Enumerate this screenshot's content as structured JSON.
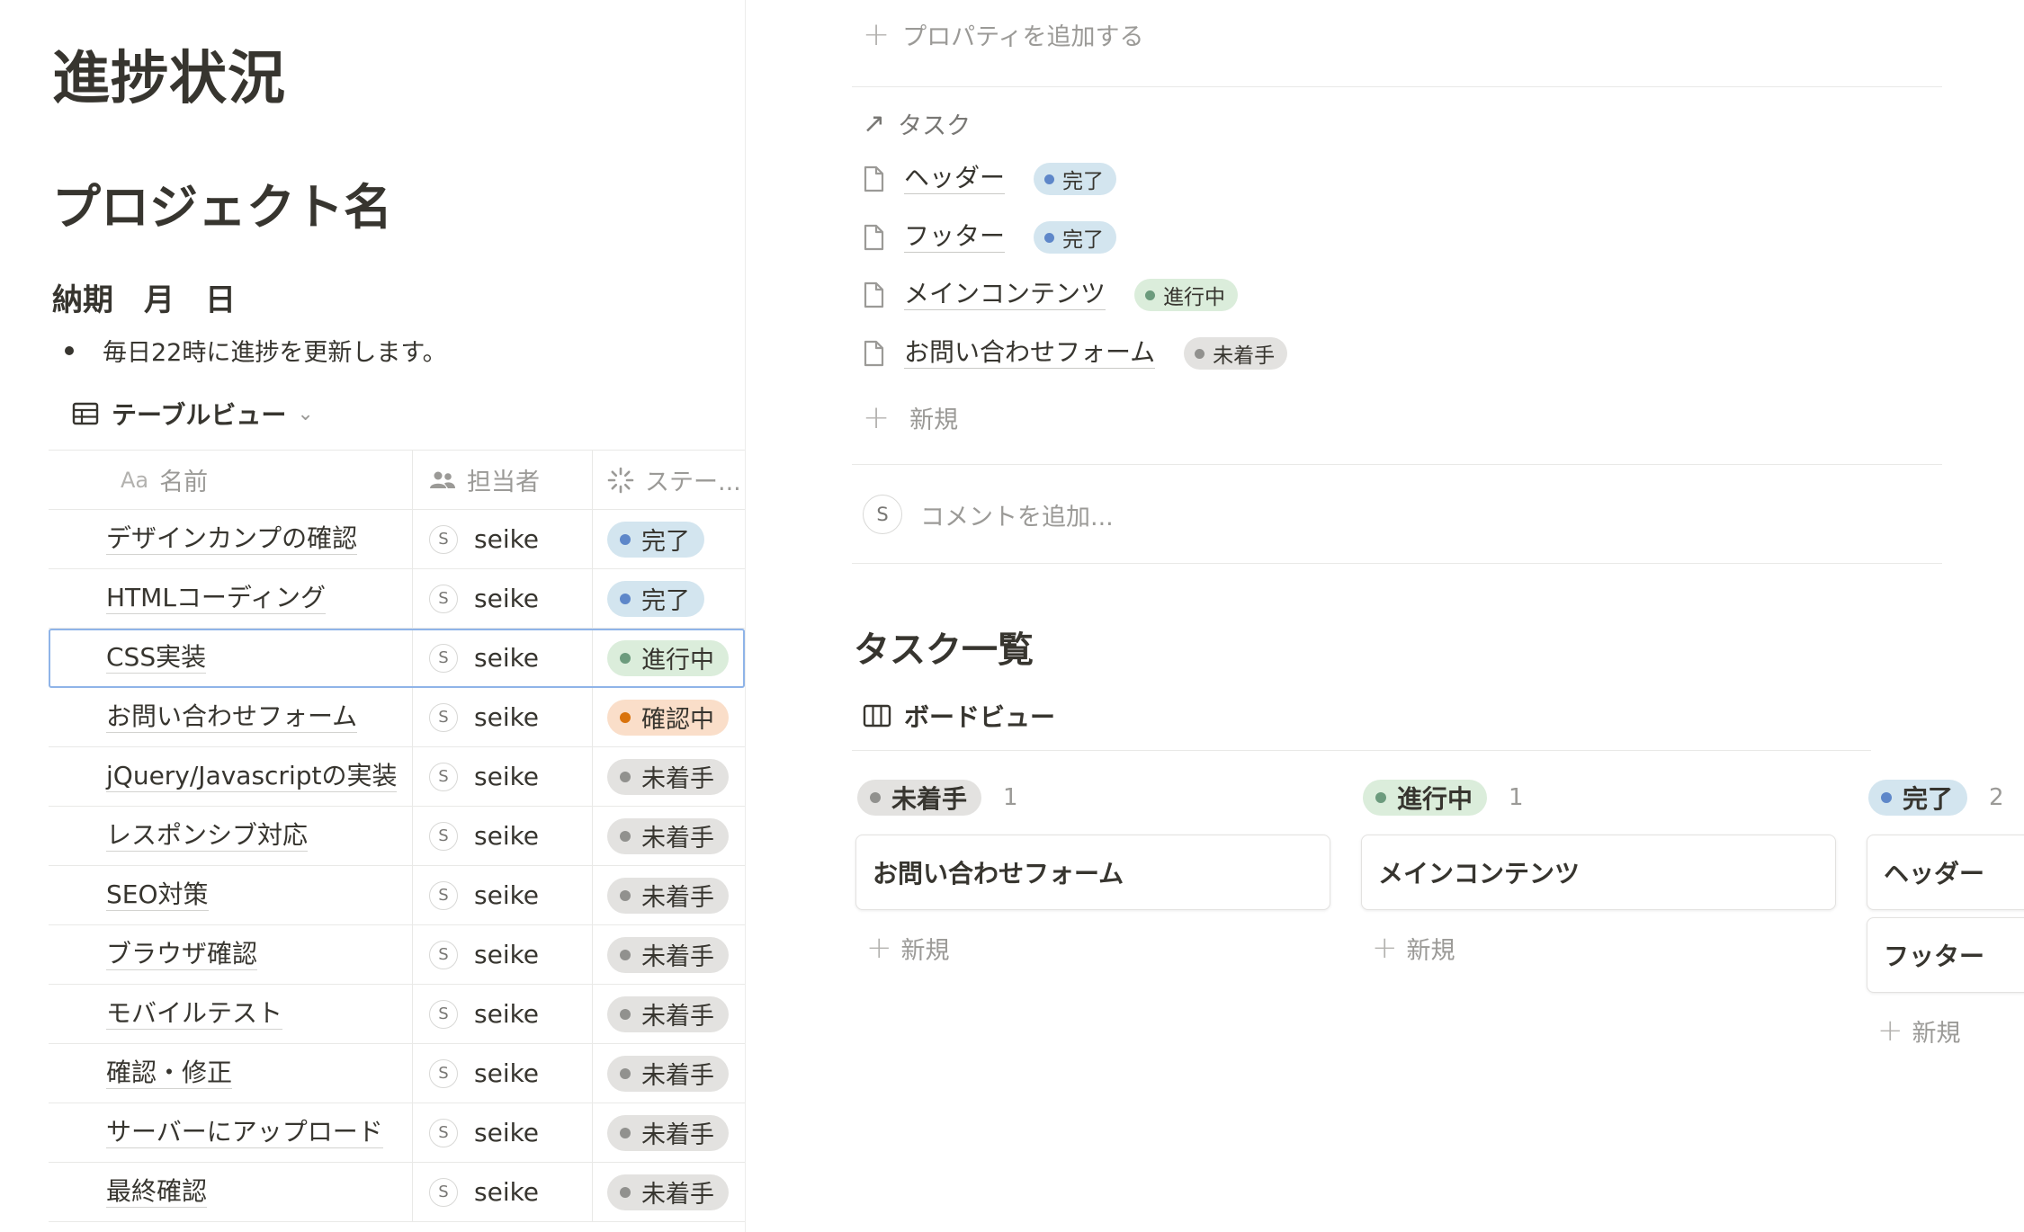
{
  "left": {
    "page_title": "進捗状況",
    "project_heading": "プロジェクト名",
    "due_heading": "納期　月　日",
    "bullet": "毎日22時に進捗を更新します。",
    "view_name": "テーブルビュー",
    "table": {
      "headers": {
        "name_prefix": "Aa",
        "name": "名前",
        "assignee": "担当者",
        "status": "ステー..."
      },
      "rows": [
        {
          "name": "デザインカンプの確認",
          "avatar": "S",
          "assignee": "seike",
          "status": "完了",
          "kind": "done"
        },
        {
          "name": "HTMLコーディング",
          "avatar": "S",
          "assignee": "seike",
          "status": "完了",
          "kind": "done"
        },
        {
          "name": "CSS実装",
          "avatar": "S",
          "assignee": "seike",
          "status": "進行中",
          "kind": "prog"
        },
        {
          "name": "お問い合わせフォーム",
          "avatar": "S",
          "assignee": "seike",
          "status": "確認中",
          "kind": "review"
        },
        {
          "name": "jQuery/Javascriptの実装",
          "avatar": "S",
          "assignee": "seike",
          "status": "未着手",
          "kind": "todo"
        },
        {
          "name": "レスポンシブ対応",
          "avatar": "S",
          "assignee": "seike",
          "status": "未着手",
          "kind": "todo"
        },
        {
          "name": "SEO対策",
          "avatar": "S",
          "assignee": "seike",
          "status": "未着手",
          "kind": "todo"
        },
        {
          "name": "ブラウザ確認",
          "avatar": "S",
          "assignee": "seike",
          "status": "未着手",
          "kind": "todo"
        },
        {
          "name": "モバイルテスト",
          "avatar": "S",
          "assignee": "seike",
          "status": "未着手",
          "kind": "todo"
        },
        {
          "name": "確認・修正",
          "avatar": "S",
          "assignee": "seike",
          "status": "未着手",
          "kind": "todo"
        },
        {
          "name": "サーバーにアップロード",
          "avatar": "S",
          "assignee": "seike",
          "status": "未着手",
          "kind": "todo"
        },
        {
          "name": "最終確認",
          "avatar": "S",
          "assignee": "seike",
          "status": "未着手",
          "kind": "todo"
        }
      ]
    }
  },
  "right": {
    "add_property": "プロパティを追加する",
    "relation_label": "タスク",
    "relations": [
      {
        "name": "ヘッダー",
        "status": "完了",
        "kind": "done"
      },
      {
        "name": "フッター",
        "status": "完了",
        "kind": "done"
      },
      {
        "name": "メインコンテンツ",
        "status": "進行中",
        "kind": "prog"
      },
      {
        "name": "お問い合わせフォーム",
        "status": "未着手",
        "kind": "todo"
      }
    ],
    "relation_new": "新規",
    "comment_avatar": "S",
    "comment_placeholder": "コメントを追加...",
    "tasks_heading": "タスク一覧",
    "board_view_name": "ボードビュー",
    "board": {
      "columns": [
        {
          "status": "未着手",
          "kind": "todo",
          "count": "1",
          "cards": [
            "お問い合わせフォーム"
          ],
          "new_label": "新規"
        },
        {
          "status": "進行中",
          "kind": "prog",
          "count": "1",
          "cards": [
            "メインコンテンツ"
          ],
          "new_label": "新規"
        },
        {
          "status": "完了",
          "kind": "done",
          "count": "2",
          "cards": [
            "ヘッダー",
            "フッター"
          ],
          "new_label": "新規"
        }
      ]
    }
  },
  "colors": {
    "done_bg": "#d3e5ef",
    "done_dot": "#5e87c9",
    "prog_bg": "#dbeddb",
    "prog_dot": "#6c9b7d",
    "review_bg": "#fadec9",
    "review_dot": "#d9730d",
    "todo_bg": "#e3e2e0",
    "todo_dot": "#91918e",
    "selection_outline": "#8fb4e8"
  },
  "icons": {
    "view_switch": "table-icon",
    "assignee_header": "people-icon",
    "status_header": "status-spinner-icon",
    "relation": "arrow-up-right-icon",
    "relation_item": "page-icon",
    "board_view": "board-icon"
  }
}
